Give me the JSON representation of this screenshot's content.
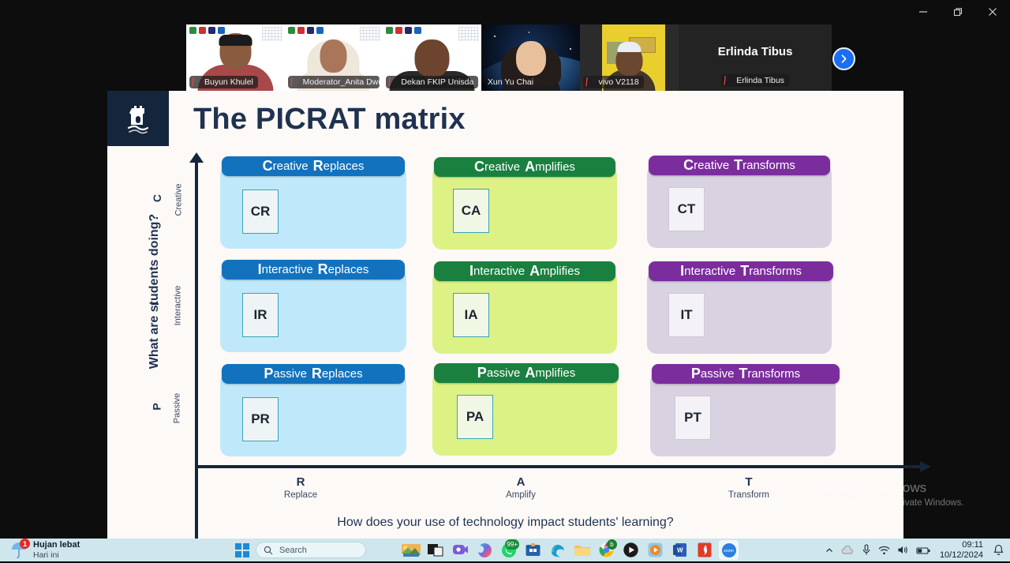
{
  "window": {
    "minimize_label": "Minimize",
    "restore_label": "Restore",
    "close_label": "Close"
  },
  "video_strip": {
    "next_button_icon": "chevron-right-icon",
    "tiles": [
      {
        "name": "Buyun Khulel",
        "muted": true,
        "speaking": false,
        "kind": "video"
      },
      {
        "name": "Moderator_Anita Dwi ...",
        "muted": true,
        "speaking": false,
        "kind": "video"
      },
      {
        "name": "Dekan FKIP Unisda",
        "muted": true,
        "speaking": false,
        "kind": "video"
      },
      {
        "name": "Xun Yu Chai",
        "muted": false,
        "speaking": true,
        "kind": "video"
      },
      {
        "name": "vivo V2118",
        "muted": true,
        "speaking": false,
        "kind": "video"
      },
      {
        "name": "Erlinda Tibus",
        "muted": true,
        "speaking": false,
        "kind": "name-only",
        "big_name": "Erlinda Tibus"
      }
    ]
  },
  "slide": {
    "title": "The PICRAT matrix",
    "logo_name": "castle-tower-logo",
    "y_axis_question": "What are students doing?",
    "x_axis_question": "How does your use of technology impact students' learning?",
    "y_ticks": [
      {
        "letter": "C",
        "word": "Creative"
      },
      {
        "letter": "I",
        "word": "Interactive"
      },
      {
        "letter": "P",
        "word": "Passive"
      }
    ],
    "x_ticks": [
      {
        "letter": "R",
        "word": "Replace"
      },
      {
        "letter": "A",
        "word": "Amplify"
      },
      {
        "letter": "T",
        "word": "Transform"
      }
    ],
    "colors": {
      "replace_header": "#1272bd",
      "replace_body": "#bfe9fa",
      "amplify_header": "#1a8040",
      "amplify_body": "#ddf285",
      "transform_header": "#7b2d9e",
      "transform_body": "#d9d2e0",
      "title": "#1f3350",
      "axis": "#15263c",
      "slide_bg": "#fdf9f7",
      "logo_bg": "#15263c"
    },
    "cells": [
      {
        "cap": "C",
        "rest": "reative",
        "cap2": "R",
        "rest2": "eplaces",
        "code": "CR",
        "col": "replace",
        "row": "creative"
      },
      {
        "cap": "C",
        "rest": "reative",
        "cap2": "A",
        "rest2": "mplifies",
        "code": "CA",
        "col": "amplify",
        "row": "creative"
      },
      {
        "cap": "C",
        "rest": "reative",
        "cap2": "T",
        "rest2": "ransforms",
        "code": "CT",
        "col": "transform",
        "row": "creative"
      },
      {
        "cap": "I",
        "rest": "nteractive",
        "cap2": "R",
        "rest2": "eplaces",
        "code": "IR",
        "col": "replace",
        "row": "interactive"
      },
      {
        "cap": "I",
        "rest": "nteractive",
        "cap2": "A",
        "rest2": "mplifies",
        "code": "IA",
        "col": "amplify",
        "row": "interactive"
      },
      {
        "cap": "I",
        "rest": "nteractive",
        "cap2": "T",
        "rest2": "ransforms",
        "code": "IT",
        "col": "transform",
        "row": "interactive"
      },
      {
        "cap": "P",
        "rest": "assive",
        "cap2": "R",
        "rest2": "eplaces",
        "code": "PR",
        "col": "replace",
        "row": "passive"
      },
      {
        "cap": "P",
        "rest": "assive",
        "cap2": "A",
        "rest2": "mplifies",
        "code": "PA",
        "col": "amplify",
        "row": "passive"
      },
      {
        "cap": "P",
        "rest": "assive",
        "cap2": "T",
        "rest2": "ransforms",
        "code": "PT",
        "col": "transform",
        "row": "passive"
      }
    ]
  },
  "watermark": {
    "title": "Activate Windows",
    "subtitle": "Go to Settings to activate Windows."
  },
  "taskbar": {
    "weather": {
      "main": "Hujan lebat",
      "sub": "Hari ini",
      "badge": "1",
      "icon": "umbrella-rain-icon"
    },
    "search": {
      "label": "Search",
      "placeholder": "Search",
      "icon": "search-icon"
    },
    "start_icon": "windows-start-icon",
    "apps": [
      {
        "name": "task-view",
        "icon": "task-view-icon"
      },
      {
        "name": "widgets-scenery",
        "icon": "scenery-icon"
      },
      {
        "name": "file-explorer-dark",
        "icon": "explorer-dark-icon"
      },
      {
        "name": "teams",
        "icon": "teams-icon"
      },
      {
        "name": "copilot",
        "icon": "copilot-icon"
      },
      {
        "name": "whatsapp",
        "icon": "whatsapp-icon",
        "badge": "99+"
      },
      {
        "name": "microsoft-store",
        "icon": "store-icon"
      },
      {
        "name": "microsoft-edge",
        "icon": "edge-icon"
      },
      {
        "name": "file-explorer",
        "icon": "folder-icon"
      },
      {
        "name": "google-chrome",
        "icon": "chrome-icon",
        "badge": "b"
      },
      {
        "name": "media-player",
        "icon": "play-circle-icon"
      },
      {
        "name": "vlc-player",
        "icon": "orange-play-icon"
      },
      {
        "name": "microsoft-word",
        "icon": "word-icon"
      },
      {
        "name": "pdf-app",
        "icon": "red-app-icon"
      },
      {
        "name": "zoom",
        "icon": "zoom-icon",
        "label": "zoom"
      }
    ],
    "tray": {
      "overflow_icon": "chevron-up-icon",
      "cloud_icon": "cloud-icon",
      "mic_icon": "microphone-icon",
      "wifi_icon": "wifi-icon",
      "volume_icon": "speaker-icon",
      "battery_icon": "battery-icon",
      "notification_icon": "bell-icon",
      "time": "09:11",
      "date": "10/12/2024"
    }
  }
}
